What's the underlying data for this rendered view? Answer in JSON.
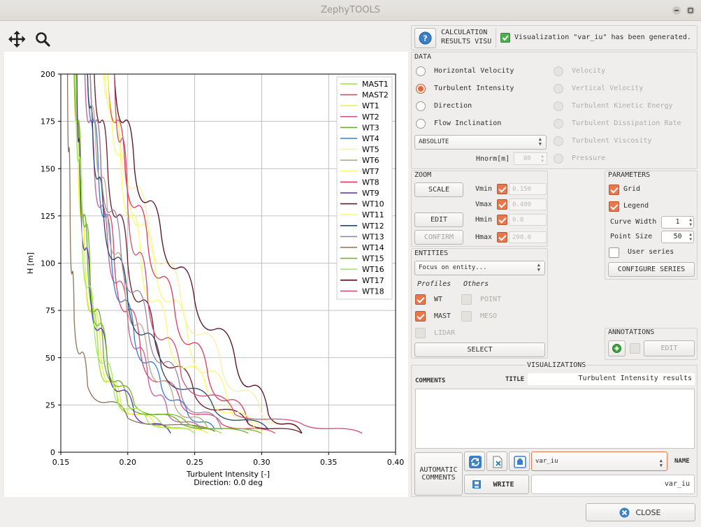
{
  "window": {
    "title": "ZephyTOOLS"
  },
  "header": {
    "panel_title_line1": "CALCULATION",
    "panel_title_line2": "RESULTS VISU",
    "status_message": "Visualization \"var_iu\" has been generated."
  },
  "data_section": {
    "title": "DATA",
    "options_left": [
      {
        "label": "Horizontal Velocity",
        "selected": false
      },
      {
        "label": "Turbulent Intensity",
        "selected": true
      },
      {
        "label": "Direction",
        "selected": false
      },
      {
        "label": "Flow Inclination",
        "selected": false
      }
    ],
    "options_right": [
      {
        "label": "Velocity"
      },
      {
        "label": "Vertical Velocity"
      },
      {
        "label": "Turbulent Kinetic Energy"
      },
      {
        "label": "Turbulent Dissipation Rate"
      },
      {
        "label": "Turbulent Viscosity"
      },
      {
        "label": "Pressure"
      }
    ],
    "mode_value": "ABSOLUTE",
    "hnorm_label": "Hnorm[m]",
    "hnorm_value": "80"
  },
  "zoom": {
    "title": "ZOOM",
    "scale_label": "SCALE",
    "edit_label": "EDIT",
    "confirm_label": "CONFIRM",
    "vmin_label": "Vmin",
    "vmin_value": "0.150",
    "vmax_label": "Vmax",
    "vmax_value": "0.400",
    "hmin_label": "Hmin",
    "hmin_value": "0.0",
    "hmax_label": "Hmax",
    "hmax_value": "200.0"
  },
  "parameters": {
    "title": "PARAMETERS",
    "grid_label": "Grid",
    "legend_label": "Legend",
    "curve_width_label": "Curve Width",
    "curve_width_value": "1",
    "point_size_label": "Point Size",
    "point_size_value": "50",
    "user_series_label": "User series",
    "configure_label": "CONFIGURE SERIES"
  },
  "entities": {
    "title": "ENTITIES",
    "focus_value": "Focus on entity...",
    "profiles_label": "Profiles",
    "others_label": "Others",
    "wt_label": "WT",
    "mast_label": "MAST",
    "lidar_label": "LIDAR",
    "point_label": "POINT",
    "meso_label": "MESO",
    "select_label": "SELECT"
  },
  "annotations": {
    "title": "ANNOTATIONS",
    "edit_label": "EDIT"
  },
  "visualizations": {
    "title": "VISUALIZATIONS",
    "comments_label": "COMMENTS",
    "title_label": "TITLE",
    "title_value": "Turbulent Intensity results",
    "auto_comments_line1": "AUTOMATIC",
    "auto_comments_line2": "COMMENTS",
    "write_label": "WRITE",
    "combo_value": "var_iu",
    "name_label": "NAME",
    "name_value": "var_iu"
  },
  "footer": {
    "close_label": "CLOSE"
  },
  "icons": {
    "pan": "move-arrows-icon",
    "zoom": "magnifier-icon",
    "help": "question-icon",
    "refresh": "refresh-icon",
    "delete": "delete-file-icon",
    "export": "export-icon",
    "write": "write-icon",
    "add": "plus-circle-icon",
    "close": "close-circle-icon"
  },
  "colors": {
    "accent": "#e8774b",
    "help_blue": "#3b80c6",
    "add_green": "#3aa33a"
  },
  "chart_data": {
    "type": "line",
    "title": "",
    "xlabel": "Turbulent Intensity [-]",
    "xlabel2": "Direction: 0.0 deg",
    "ylabel": "H [m]",
    "xlim": [
      0.15,
      0.4
    ],
    "ylim": [
      0,
      200
    ],
    "xticks": [
      "0.15",
      "0.20",
      "0.25",
      "0.30",
      "0.35",
      "0.40"
    ],
    "yticks": [
      "0",
      "25",
      "50",
      "75",
      "100",
      "125",
      "150",
      "175",
      "200"
    ],
    "grid": true,
    "legend": "top-right",
    "series": [
      {
        "name": "MAST1",
        "color": "#98e23a",
        "points": [
          [
            0.27,
            10
          ],
          [
            0.225,
            15
          ],
          [
            0.193,
            25
          ],
          [
            0.178,
            50
          ],
          [
            0.168,
            100
          ],
          [
            0.164,
            150
          ],
          [
            0.162,
            200
          ]
        ]
      },
      {
        "name": "MAST2",
        "color": "#e0406a",
        "points": [
          [
            0.31,
            10
          ],
          [
            0.27,
            15
          ],
          [
            0.24,
            25
          ],
          [
            0.21,
            50
          ],
          [
            0.19,
            100
          ],
          [
            0.18,
            150
          ],
          [
            0.172,
            200
          ]
        ]
      },
      {
        "name": "WT1",
        "color": "#f2f03a",
        "points": [
          [
            0.26,
            10
          ],
          [
            0.22,
            15
          ],
          [
            0.195,
            25
          ],
          [
            0.18,
            50
          ],
          [
            0.168,
            100
          ],
          [
            0.163,
            150
          ],
          [
            0.16,
            200
          ]
        ]
      },
      {
        "name": "WT2",
        "color": "#cc5a9a",
        "points": [
          [
            0.255,
            12
          ],
          [
            0.23,
            20
          ],
          [
            0.215,
            40
          ],
          [
            0.2,
            70
          ],
          [
            0.185,
            110
          ],
          [
            0.175,
            150
          ],
          [
            0.168,
            200
          ]
        ]
      },
      {
        "name": "WT3",
        "color": "#6aaa3a",
        "points": [
          [
            0.29,
            10
          ],
          [
            0.24,
            15
          ],
          [
            0.2,
            25
          ],
          [
            0.182,
            50
          ],
          [
            0.17,
            100
          ],
          [
            0.164,
            150
          ],
          [
            0.161,
            200
          ]
        ]
      },
      {
        "name": "WT4",
        "color": "#3a7ad6",
        "points": [
          [
            0.265,
            12
          ],
          [
            0.245,
            20
          ],
          [
            0.225,
            35
          ],
          [
            0.205,
            60
          ],
          [
            0.188,
            100
          ],
          [
            0.178,
            150
          ],
          [
            0.17,
            200
          ]
        ]
      },
      {
        "name": "WT5",
        "color": "#f7f0a6",
        "points": [
          [
            0.33,
            10
          ],
          [
            0.3,
            20
          ],
          [
            0.27,
            45
          ],
          [
            0.24,
            80
          ],
          [
            0.215,
            120
          ],
          [
            0.195,
            160
          ],
          [
            0.183,
            200
          ]
        ]
      },
      {
        "name": "WT6",
        "color": "#bea88a",
        "points": [
          [
            0.26,
            12
          ],
          [
            0.235,
            25
          ],
          [
            0.215,
            50
          ],
          [
            0.198,
            85
          ],
          [
            0.185,
            125
          ],
          [
            0.176,
            165
          ],
          [
            0.17,
            200
          ]
        ]
      },
      {
        "name": "WT7",
        "color": "#fafa78",
        "points": [
          [
            0.3,
            10
          ],
          [
            0.275,
            25
          ],
          [
            0.245,
            60
          ],
          [
            0.22,
            100
          ],
          [
            0.2,
            140
          ],
          [
            0.188,
            175
          ],
          [
            0.182,
            200
          ]
        ]
      },
      {
        "name": "WT8",
        "color": "#e03a5a",
        "points": [
          [
            0.29,
            15
          ],
          [
            0.26,
            40
          ],
          [
            0.235,
            75
          ],
          [
            0.215,
            110
          ],
          [
            0.198,
            150
          ],
          [
            0.185,
            200
          ]
        ]
      },
      {
        "name": "WT9",
        "color": "#5a2ab4",
        "points": [
          [
            0.232,
            10
          ],
          [
            0.205,
            20
          ],
          [
            0.185,
            45
          ],
          [
            0.172,
            85
          ],
          [
            0.165,
            130
          ],
          [
            0.162,
            200
          ]
        ]
      },
      {
        "name": "WT10",
        "color": "#6a1a28",
        "points": [
          [
            0.33,
            10
          ],
          [
            0.29,
            15
          ],
          [
            0.25,
            30
          ],
          [
            0.22,
            60
          ],
          [
            0.2,
            100
          ],
          [
            0.185,
            150
          ],
          [
            0.175,
            200
          ]
        ]
      },
      {
        "name": "WT11",
        "color": "#fcfc6a",
        "points": [
          [
            0.295,
            12
          ],
          [
            0.26,
            30
          ],
          [
            0.23,
            60
          ],
          [
            0.21,
            100
          ],
          [
            0.195,
            150
          ],
          [
            0.185,
            200
          ]
        ]
      },
      {
        "name": "WT12",
        "color": "#24476e",
        "points": [
          [
            0.305,
            12
          ],
          [
            0.265,
            22
          ],
          [
            0.225,
            45
          ],
          [
            0.2,
            80
          ],
          [
            0.182,
            125
          ],
          [
            0.174,
            165
          ],
          [
            0.17,
            200
          ]
        ]
      },
      {
        "name": "WT13",
        "color": "#9b83a8",
        "points": [
          [
            0.27,
            12
          ],
          [
            0.24,
            30
          ],
          [
            0.215,
            65
          ],
          [
            0.195,
            105
          ],
          [
            0.18,
            150
          ],
          [
            0.172,
            200
          ]
        ]
      },
      {
        "name": "WT14",
        "color": "#8e7456",
        "points": [
          [
            0.265,
            11
          ],
          [
            0.2,
            18
          ],
          [
            0.17,
            35
          ],
          [
            0.16,
            70
          ],
          [
            0.157,
            120
          ],
          [
            0.155,
            200
          ]
        ]
      },
      {
        "name": "WT15",
        "color": "#76b822",
        "points": [
          [
            0.3,
            10
          ],
          [
            0.245,
            15
          ],
          [
            0.205,
            25
          ],
          [
            0.185,
            45
          ],
          [
            0.172,
            90
          ],
          [
            0.165,
            150
          ],
          [
            0.16,
            200
          ]
        ]
      },
      {
        "name": "WT16",
        "color": "#a0ec58",
        "points": [
          [
            0.25,
            10
          ],
          [
            0.215,
            16
          ],
          [
            0.19,
            30
          ],
          [
            0.175,
            65
          ],
          [
            0.166,
            110
          ],
          [
            0.161,
            200
          ]
        ]
      },
      {
        "name": "WT17",
        "color": "#560a1c",
        "points": [
          [
            0.33,
            10
          ],
          [
            0.305,
            20
          ],
          [
            0.28,
            50
          ],
          [
            0.25,
            80
          ],
          [
            0.225,
            115
          ],
          [
            0.205,
            150
          ],
          [
            0.19,
            200
          ]
        ]
      },
      {
        "name": "WT18",
        "color": "#d24e76",
        "points": [
          [
            0.375,
            10
          ],
          [
            0.33,
            15
          ],
          [
            0.28,
            20
          ],
          [
            0.24,
            40
          ],
          [
            0.215,
            80
          ],
          [
            0.2,
            130
          ],
          [
            0.19,
            200
          ]
        ]
      }
    ]
  }
}
